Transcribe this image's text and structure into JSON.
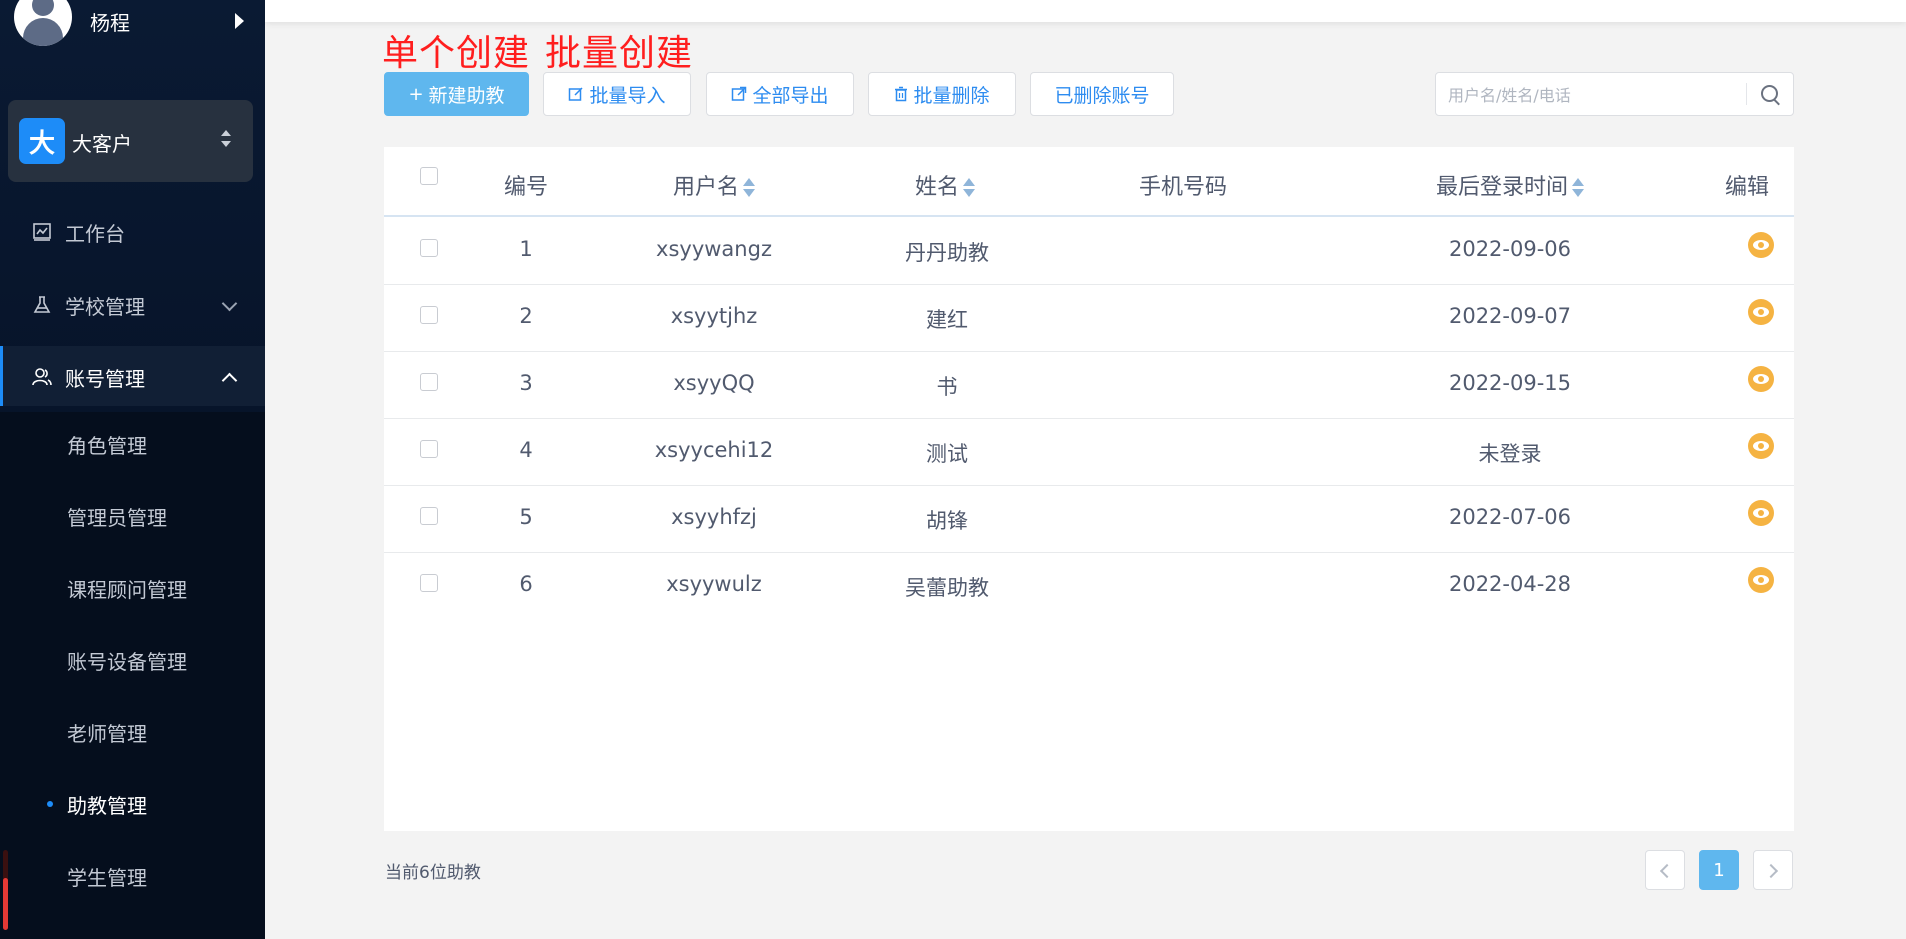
{
  "sidebar": {
    "user_name": "杨程",
    "org_name": "大客户",
    "org_icon_char": "大",
    "menu": {
      "workbench": "工作台",
      "school": "学校管理",
      "account": "账号管理"
    },
    "submenu": [
      "角色管理",
      "管理员管理",
      "课程顾问管理",
      "账号设备管理",
      "老师管理",
      "助教管理",
      "学生管理"
    ],
    "active_submenu": "助教管理"
  },
  "annotations": {
    "single": "单个创建",
    "batch": "批量创建"
  },
  "toolbar": {
    "new": "新建助教",
    "import": "批量导入",
    "export": "全部导出",
    "delete": "批量删除",
    "deleted": "已删除账号"
  },
  "search": {
    "placeholder": "用户名/姓名/电话",
    "value": ""
  },
  "table": {
    "headers": {
      "id": "编号",
      "username": "用户名",
      "name": "姓名",
      "phone": "手机号码",
      "last_login": "最后登录时间",
      "edit": "编辑"
    },
    "rows": [
      {
        "id": "1",
        "username": "xsyywangz",
        "name": "丹丹助教",
        "phone": "",
        "last_login": "2022-09-06"
      },
      {
        "id": "2",
        "username": "xsyytjhz",
        "name": "建红",
        "phone": "",
        "last_login": "2022-09-07"
      },
      {
        "id": "3",
        "username": "xsyyQQ",
        "name": "书",
        "phone": "",
        "last_login": "2022-09-15"
      },
      {
        "id": "4",
        "username": "xsyycehi12",
        "name": "测试",
        "phone": "",
        "last_login": "未登录"
      },
      {
        "id": "5",
        "username": "xsyyhfzj",
        "name": "胡锋",
        "phone": "",
        "last_login": "2022-07-06"
      },
      {
        "id": "6",
        "username": "xsyywulz",
        "name": "吴蕾助教",
        "phone": "",
        "last_login": "2022-04-28"
      }
    ]
  },
  "footer": {
    "count_text": "当前6位助教",
    "current_page": "1"
  },
  "colors": {
    "primary": "#5fb7ee",
    "link": "#2d8cf0",
    "annotation": "#ff1e1e",
    "eye": "#f5b342",
    "sidebar_accent": "#1d8cf8"
  }
}
